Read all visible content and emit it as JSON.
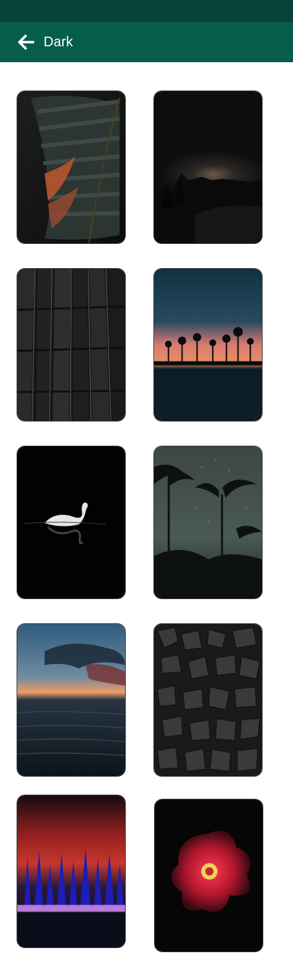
{
  "app_bar": {
    "title": "Dark",
    "back_icon": "arrow-left-icon"
  },
  "colors": {
    "status_bar": "#054436",
    "app_bar": "#065d4c",
    "title_text": "#ffffff",
    "background": "#ffffff"
  },
  "wallpapers": [
    {
      "name": "dark-leaf"
    },
    {
      "name": "night-mountains"
    },
    {
      "name": "dark-building"
    },
    {
      "name": "palm-sunset"
    },
    {
      "name": "swan"
    },
    {
      "name": "palm-stars"
    },
    {
      "name": "ocean-sunset"
    },
    {
      "name": "dark-rocks"
    },
    {
      "name": "neon-forest"
    },
    {
      "name": "red-flower"
    }
  ]
}
